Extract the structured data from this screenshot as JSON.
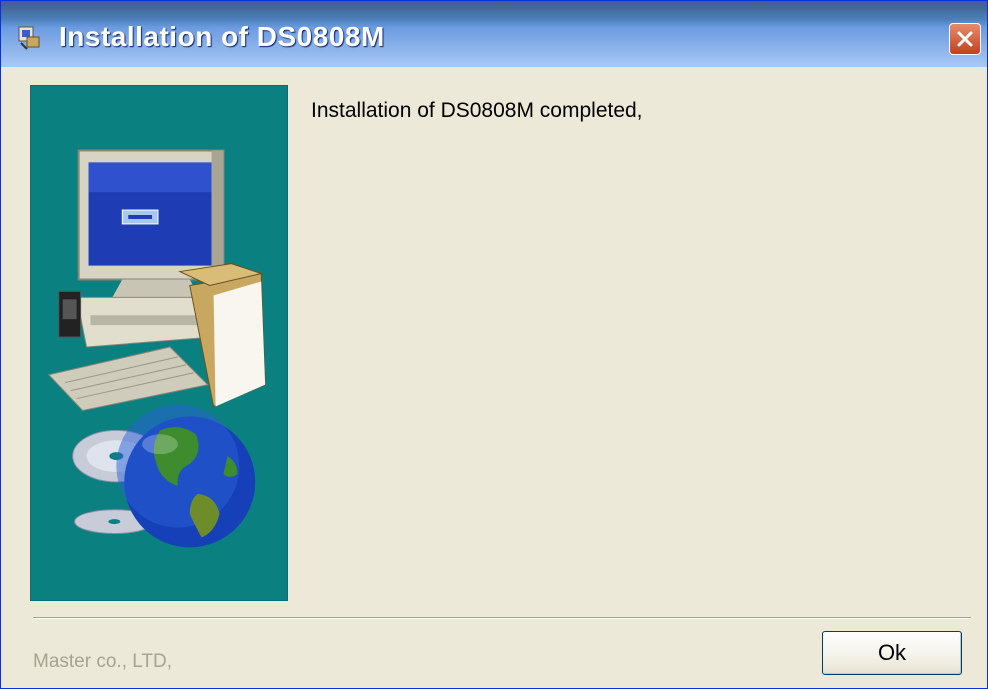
{
  "window": {
    "title": "Installation of DS0808M",
    "close_icon": "close-icon",
    "app_icon": "installer-icon"
  },
  "content": {
    "message": "Installation of DS0808M completed,",
    "side_image": "computer-with-globe-and-cds-illustration"
  },
  "footer": {
    "company": "Master co., LTD,",
    "ok_label": "Ok"
  },
  "colors": {
    "titlebar": "#3A6EA5",
    "panel_bg": "#0B8080",
    "dialog_bg": "#ECE9D8",
    "close_red": "#C2411F"
  }
}
